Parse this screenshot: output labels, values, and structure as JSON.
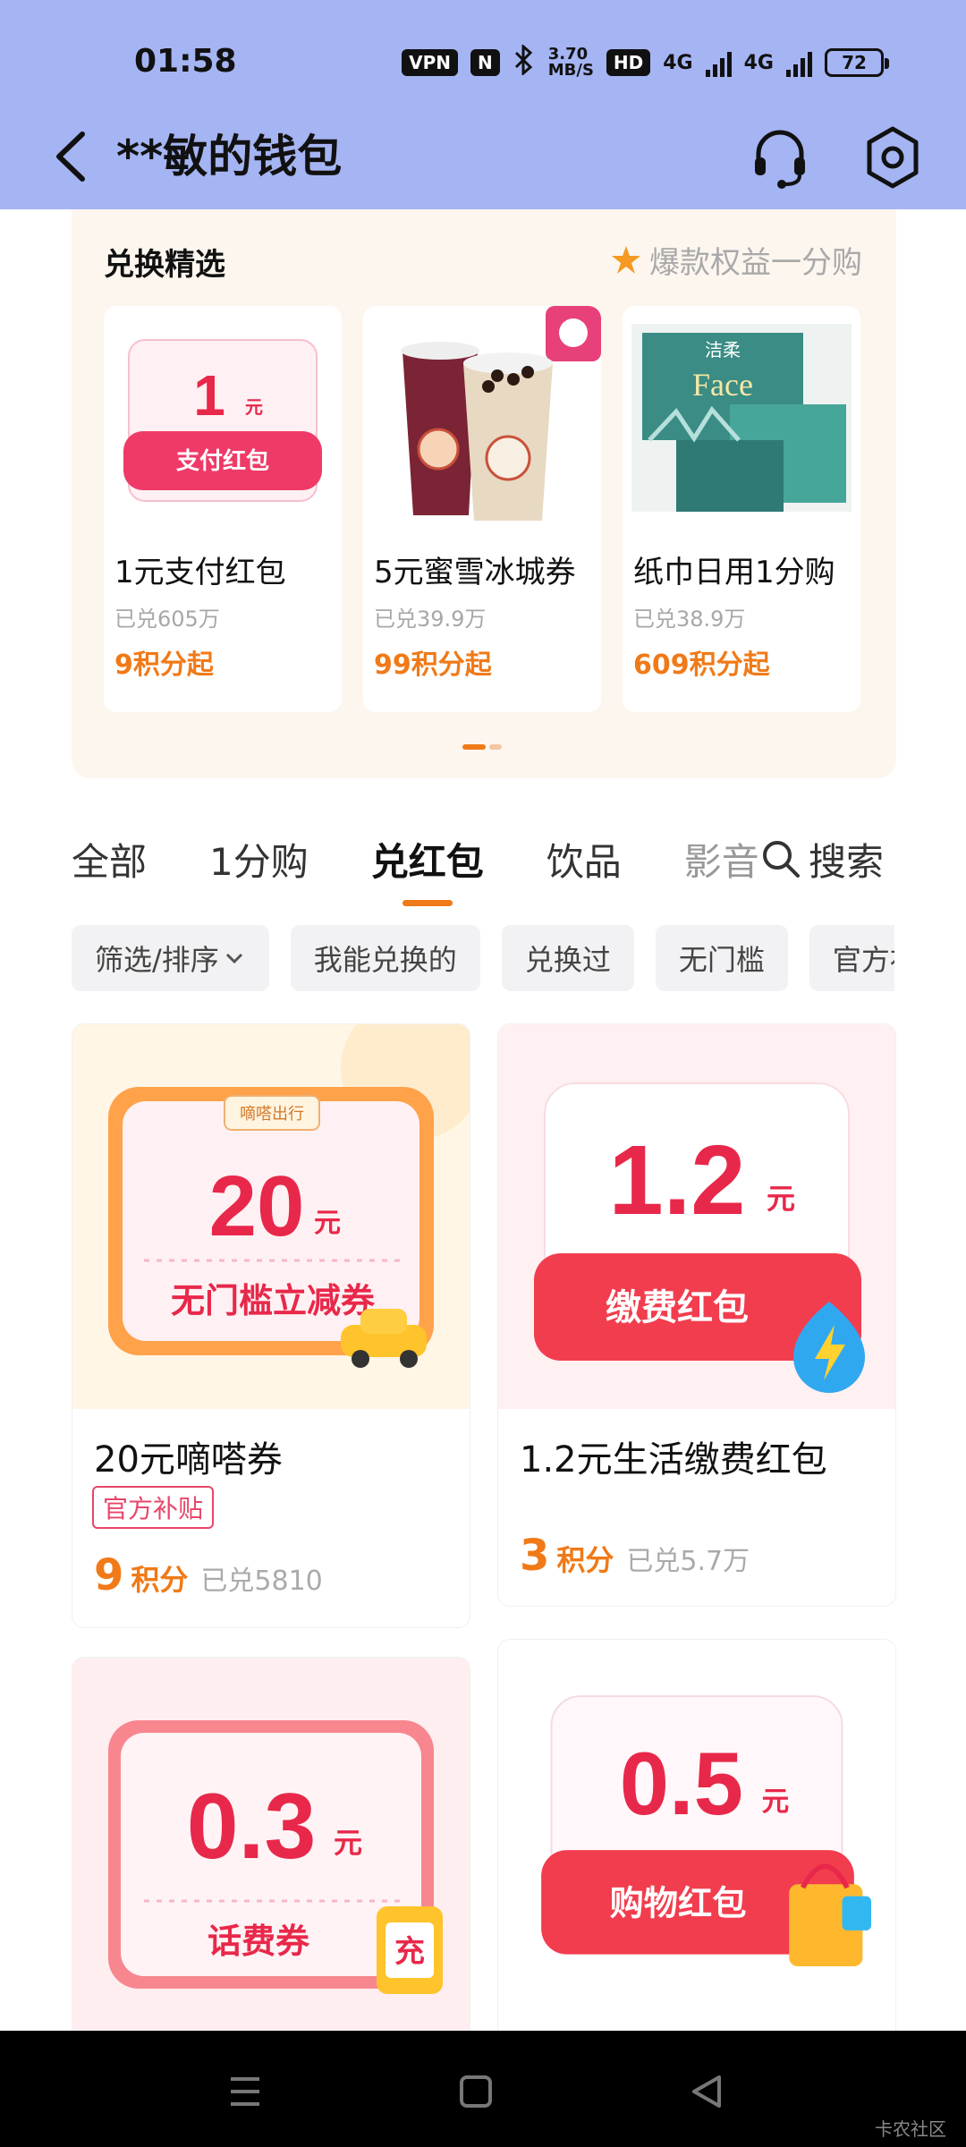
{
  "status_bar": {
    "time": "01:58",
    "vpn": "VPN",
    "nfc": "N",
    "speed_value": "3.70",
    "speed_unit": "MB/S",
    "hd": "HD",
    "net1": "4G",
    "net2": "4G",
    "battery": "72"
  },
  "header": {
    "title": "**敏的钱包",
    "icons": [
      "back-icon",
      "headset-icon",
      "gear-icon"
    ],
    "bg_color": "#a5b4f2"
  },
  "exchange": {
    "title": "兑换精选",
    "promo": "爆款权益一分购",
    "products": [
      {
        "name": "1元支付红包",
        "sold": "已兑605万",
        "price": "9积分起",
        "art_amount": "1",
        "art_unit": "元",
        "art_label": "支付红包"
      },
      {
        "name": "5元蜜雪冰城券",
        "sold": "已兑39.9万",
        "price": "99积分起"
      },
      {
        "name": "纸巾日用1分购",
        "sold": "已兑38.9万",
        "price": "609积分起",
        "art_brand": "洁柔",
        "art_word": "Face"
      }
    ]
  },
  "tabs": [
    {
      "label": "全部",
      "active": false
    },
    {
      "label": "1分购",
      "active": false
    },
    {
      "label": "兑红包",
      "active": true
    },
    {
      "label": "饮品",
      "active": false
    },
    {
      "label": "影音",
      "active": false
    }
  ],
  "search_label": "搜索",
  "chips": [
    "筛选/排序",
    "我能兑换的",
    "兑换过",
    "无门槛",
    "官方补贴"
  ],
  "coupons": [
    {
      "name": "20元嘀嗒券",
      "tag": "官方补贴",
      "points": "9",
      "unit": "积分",
      "sold": "已兑5810",
      "art_amount": "20",
      "art_unit": "元",
      "art_label": "无门槛立减券",
      "art_brand": "嘀嗒出行"
    },
    {
      "name": "1.2元生活缴费红包",
      "points": "3",
      "unit": "积分",
      "sold": "已兑5.7万",
      "art_amount": "1.2",
      "art_unit": "元",
      "art_label": "缴费红包"
    },
    {
      "art_amount": "0.3",
      "art_unit": "元",
      "art_label": "话费券",
      "art_badge": "充"
    },
    {
      "art_amount": "0.5",
      "art_unit": "元",
      "art_label": "购物红包"
    }
  ],
  "watermark": "卡农社区",
  "colors": {
    "accent": "#f07a18",
    "red": "#e8284a",
    "tag": "#e8466a"
  }
}
